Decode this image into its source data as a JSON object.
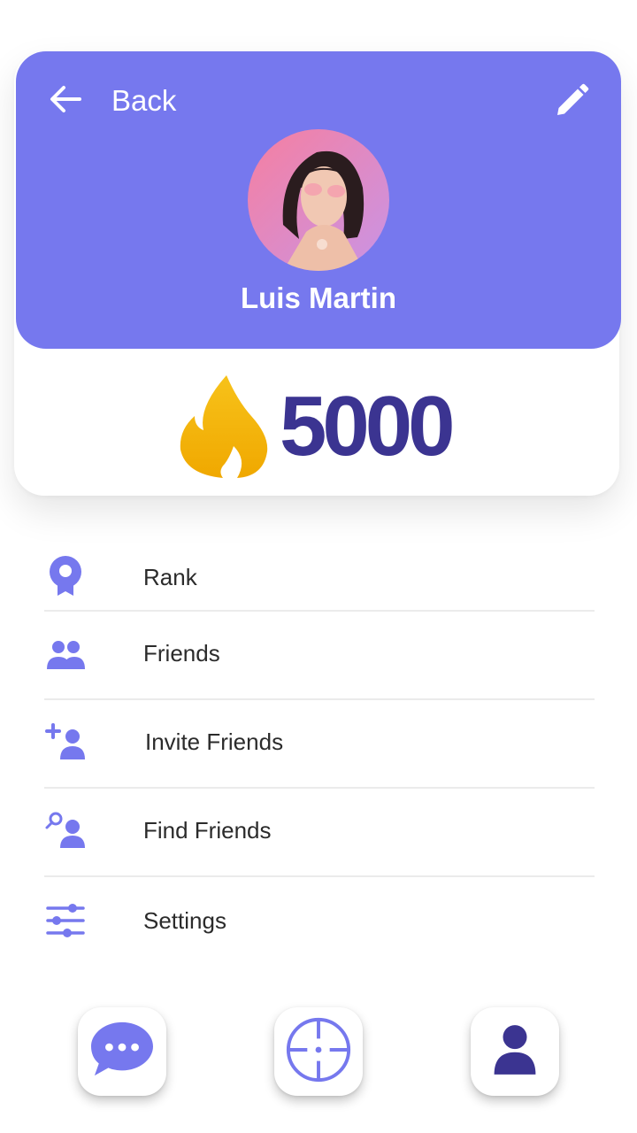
{
  "header": {
    "back_label": "Back",
    "back_icon": "arrow-left-icon",
    "edit_icon": "pencil-icon",
    "background_color": "#7678ee"
  },
  "profile": {
    "name": "Luis Martin",
    "avatar": "profile-photo"
  },
  "score": {
    "value": "5000",
    "icon": "flame-icon",
    "color": "#3b3491",
    "icon_color": "#f5b800"
  },
  "menu": {
    "items": [
      {
        "label": "Rank",
        "icon": "award-icon"
      },
      {
        "label": "Friends",
        "icon": "people-icon"
      },
      {
        "label": "Invite Friends",
        "icon": "add-person-icon"
      },
      {
        "label": "Find Friends",
        "icon": "search-person-icon"
      },
      {
        "label": "Settings",
        "icon": "sliders-icon"
      }
    ],
    "icon_color": "#7678ee"
  },
  "bottom_nav": {
    "items": [
      {
        "icon": "chat-bubble-icon"
      },
      {
        "icon": "crosshair-icon"
      },
      {
        "icon": "user-icon"
      }
    ]
  }
}
